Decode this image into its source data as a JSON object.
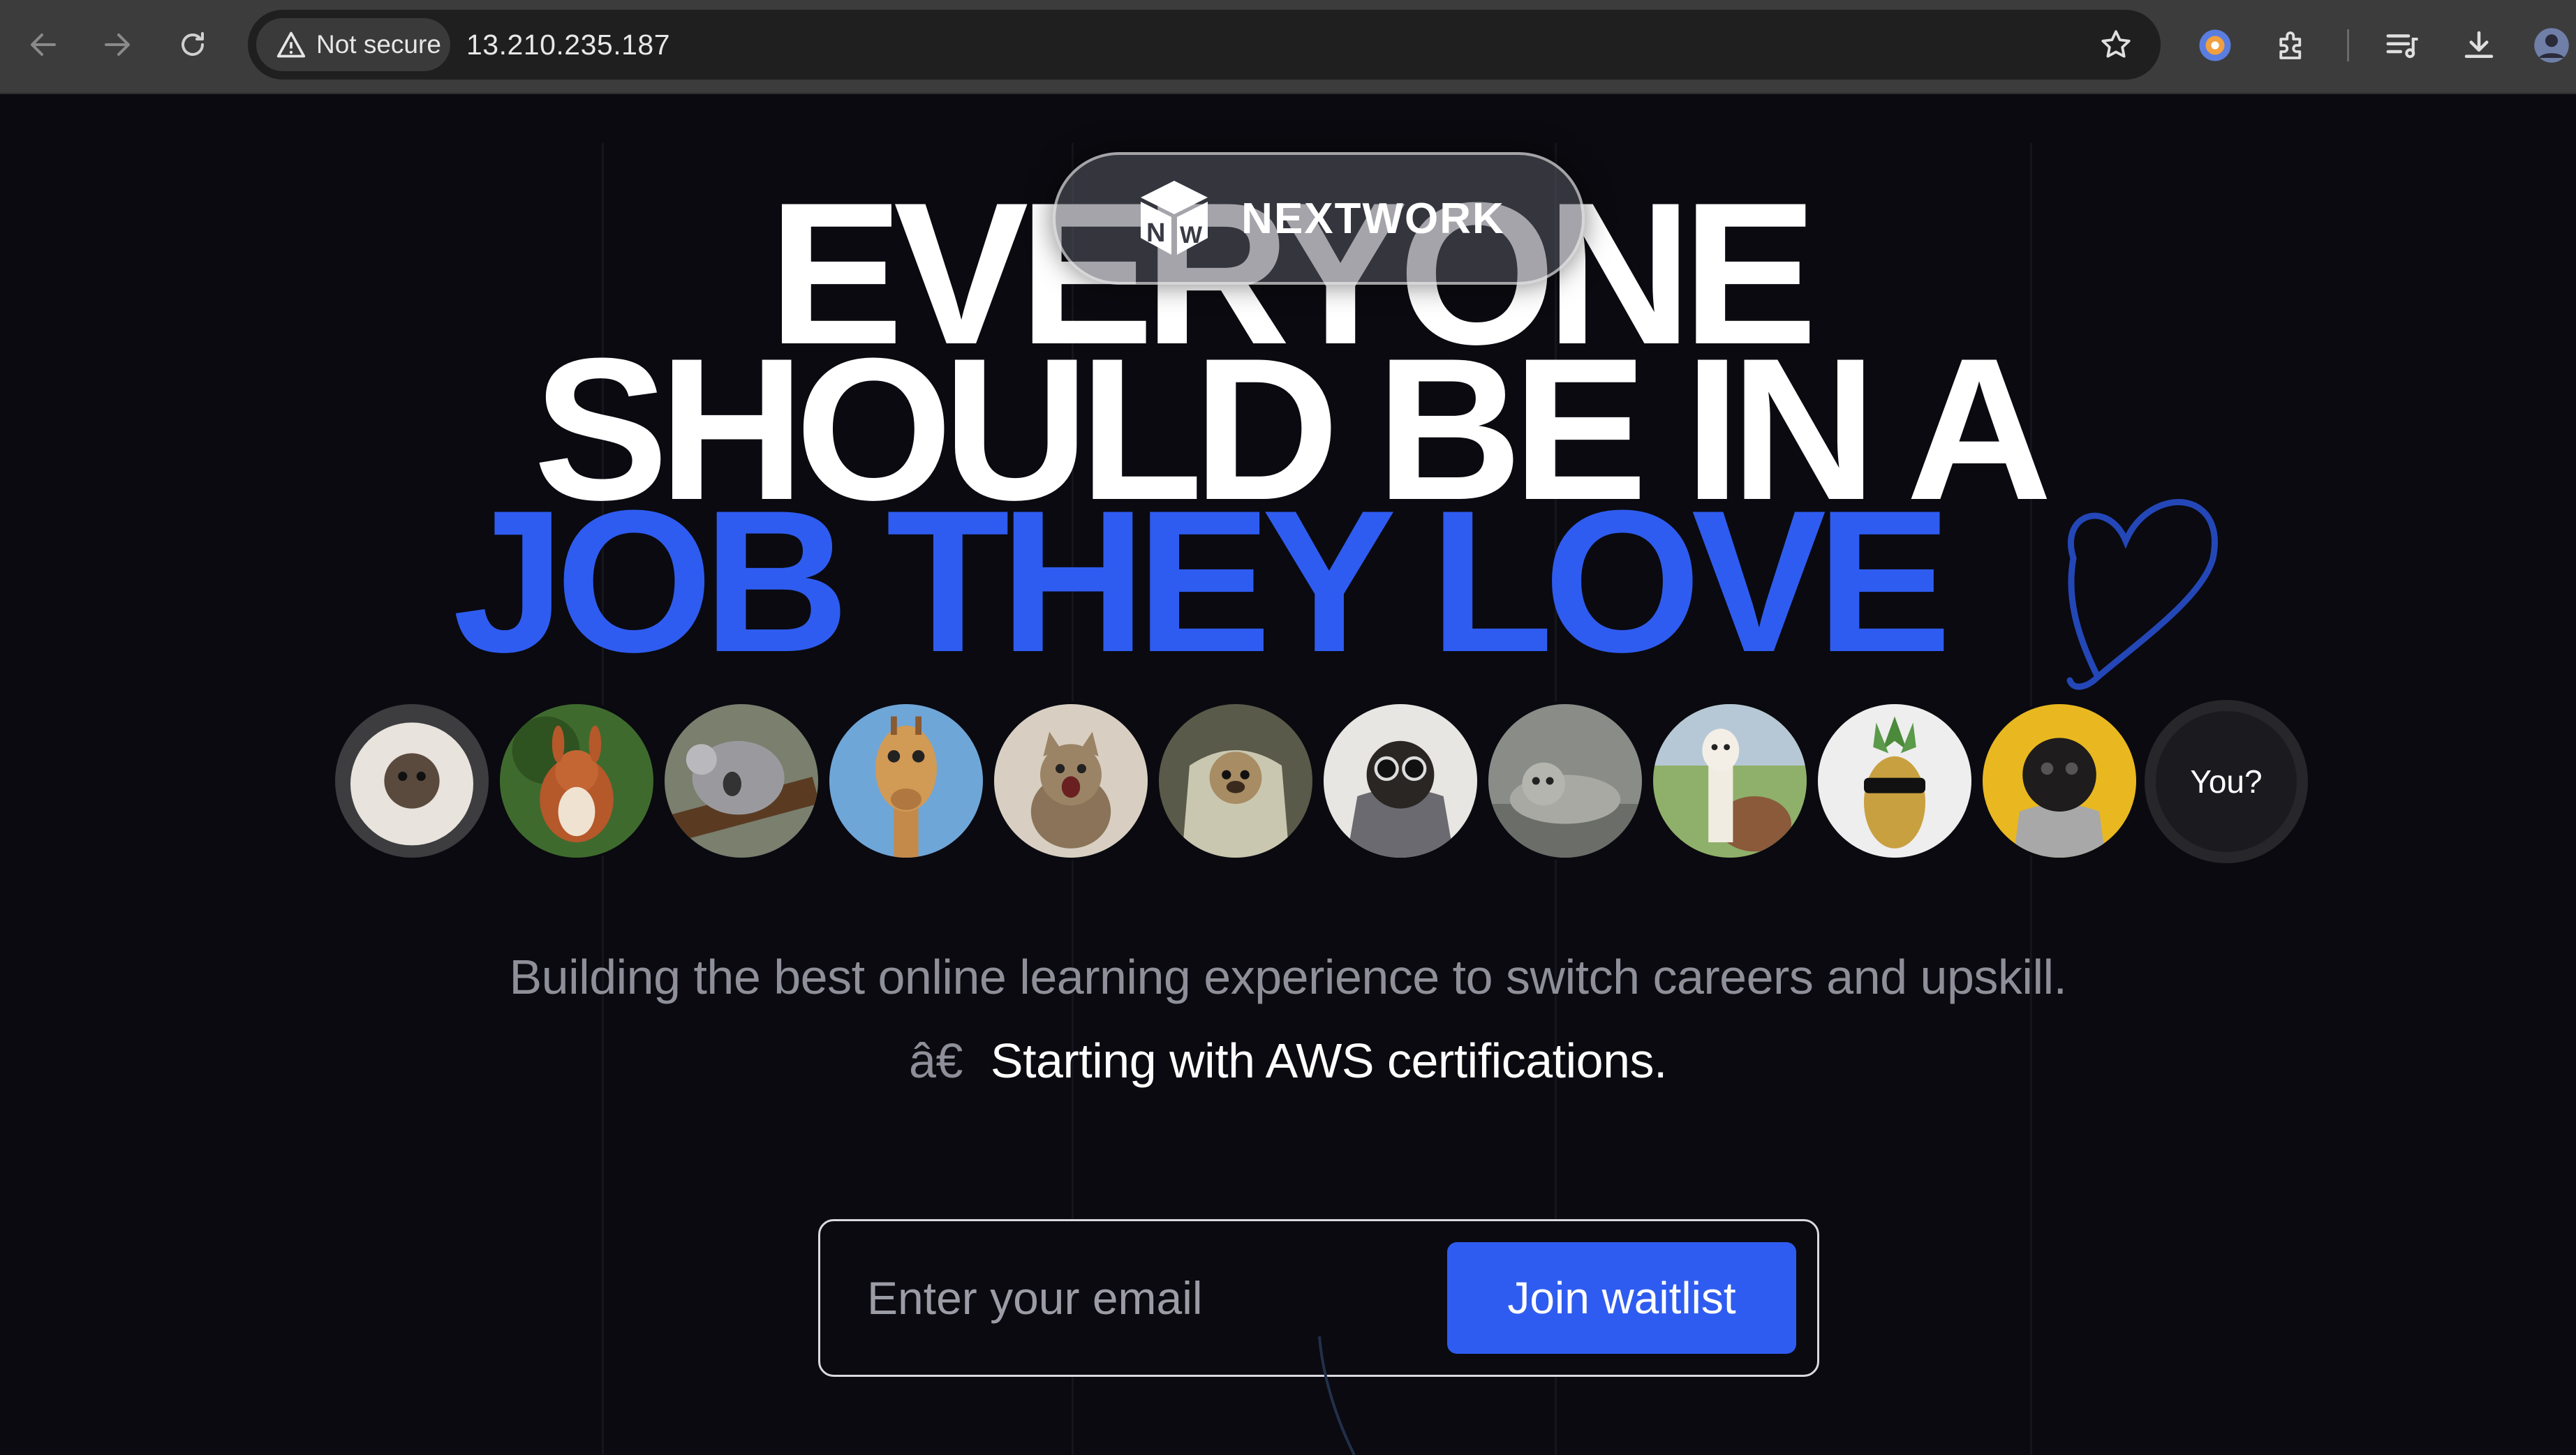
{
  "browser": {
    "security_label": "Not secure",
    "url": "13.210.235.187"
  },
  "logo": {
    "text": "NEXTWORK",
    "mark": "NW"
  },
  "hero": {
    "line1": "EVERYONE",
    "line2": "SHOULD BE IN A",
    "line3": "JOB THEY LOVE",
    "accent_color": "#2f5cf0"
  },
  "avatars": [
    {
      "name": "pug-in-fur-hood"
    },
    {
      "name": "red-squirrel"
    },
    {
      "name": "sleeping-koala"
    },
    {
      "name": "giraffe"
    },
    {
      "name": "shouting-kitten"
    },
    {
      "name": "pug-in-blanket"
    },
    {
      "name": "pug-with-glasses"
    },
    {
      "name": "seal"
    },
    {
      "name": "alpaca"
    },
    {
      "name": "pineapple-with-sunglasses"
    },
    {
      "name": "black-pug-yellow-bg"
    }
  ],
  "avatar_you_label": "You?",
  "subtitle": "Building the best online learning experience to switch careers and upskill.",
  "subtitle2_mark": "â€",
  "subtitle2": "Starting with AWS certifications.",
  "form": {
    "email_placeholder": "Enter your email",
    "submit_label": "Join waitlist"
  }
}
